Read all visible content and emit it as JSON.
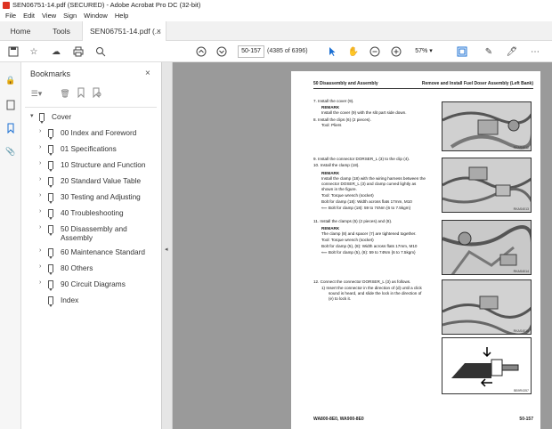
{
  "window": {
    "title": "SEN06751-14.pdf (SECURED) - Adobe Acrobat Pro DC (32-bit)"
  },
  "menu": [
    "File",
    "Edit",
    "View",
    "Sign",
    "Window",
    "Help"
  ],
  "tabs": {
    "home": "Home",
    "tools": "Tools",
    "doc": "SEN06751-14.pdf (..."
  },
  "toolbar": {
    "page_input": "50-157",
    "page_count": "(4385 of 6396)",
    "zoom": "57%"
  },
  "bookmarks": {
    "title": "Bookmarks",
    "items": [
      {
        "label": "Cover"
      },
      {
        "label": "00 Index and Foreword"
      },
      {
        "label": "01 Specifications"
      },
      {
        "label": "10 Structure and Function"
      },
      {
        "label": "20 Standard Value Table"
      },
      {
        "label": "30 Testing and Adjusting"
      },
      {
        "label": "40 Troubleshooting"
      },
      {
        "label": "50 Disassembly and Assembly"
      },
      {
        "label": "60 Maintenance Standard"
      },
      {
        "label": "80 Others"
      },
      {
        "label": "90 Circuit Diagrams"
      },
      {
        "label": "Index"
      }
    ]
  },
  "document": {
    "header_left": "50 Disassembly and Assembly",
    "header_right": "Remove and Install Fuel Doser Assembly (Left Bank)",
    "footer_left": "WA800-8E0, WA900-8E0",
    "footer_right": "50-157",
    "steps": {
      "s7": "7.   Install the cover (9).",
      "s7_remark": "REMARK",
      "s7_note": "Install the cover (9) with the slit part side down.",
      "s8": "8.   Install the clips (6) (2 pieces).",
      "s8_tool": "Tool: Pliers",
      "s9": "9.   Install the connector DORSER_L (3) to the clip (4).",
      "s10": "10.  Install the clamp (18).",
      "s10_remark": "REMARK",
      "s10_note1": "Install the clamp (18) with the wiring harness between the",
      "s10_note2": "connector DOSER_L (3) and clamp curved lightly as",
      "s10_note3": "shown in the figure.",
      "s10_tool": "Tool: Torque wrench (socket)",
      "s10_bolt": "Bolt for clamp (18): Width across flats 17mm, M10",
      "s10_torque": "Bolt for clamp (18): 59 to 74Nm {6 to 7.5kgm}",
      "s11": "11.  Install the clamps (5) (2 pieces) and (8).",
      "s11_remark": "REMARK",
      "s11_note": "The clamp (8) and spacer (7) are tightened together.",
      "s11_tool": "Tool: Torque wrench (socket)",
      "s11_bolt": "Bolt for clamp (5), (8): Width across flats 17mm, M10",
      "s11_torque": "Bolt for clamp (5), (8): 59 to 74Nm {6 to 7.5kgm}",
      "s12": "12.  Connect the connector DORSER_L (3) as follows.",
      "s12_1a": "1)   Insert the connector in the direction of (d) until a click",
      "s12_1b": "sound is heard, and slide the lock in the direction of",
      "s12_1c": "(e) to lock it."
    },
    "figure_ids": [
      "RKAS4012",
      "RKAS4013",
      "RKAS4014",
      "RKAS4015",
      "BB9R4357"
    ]
  }
}
